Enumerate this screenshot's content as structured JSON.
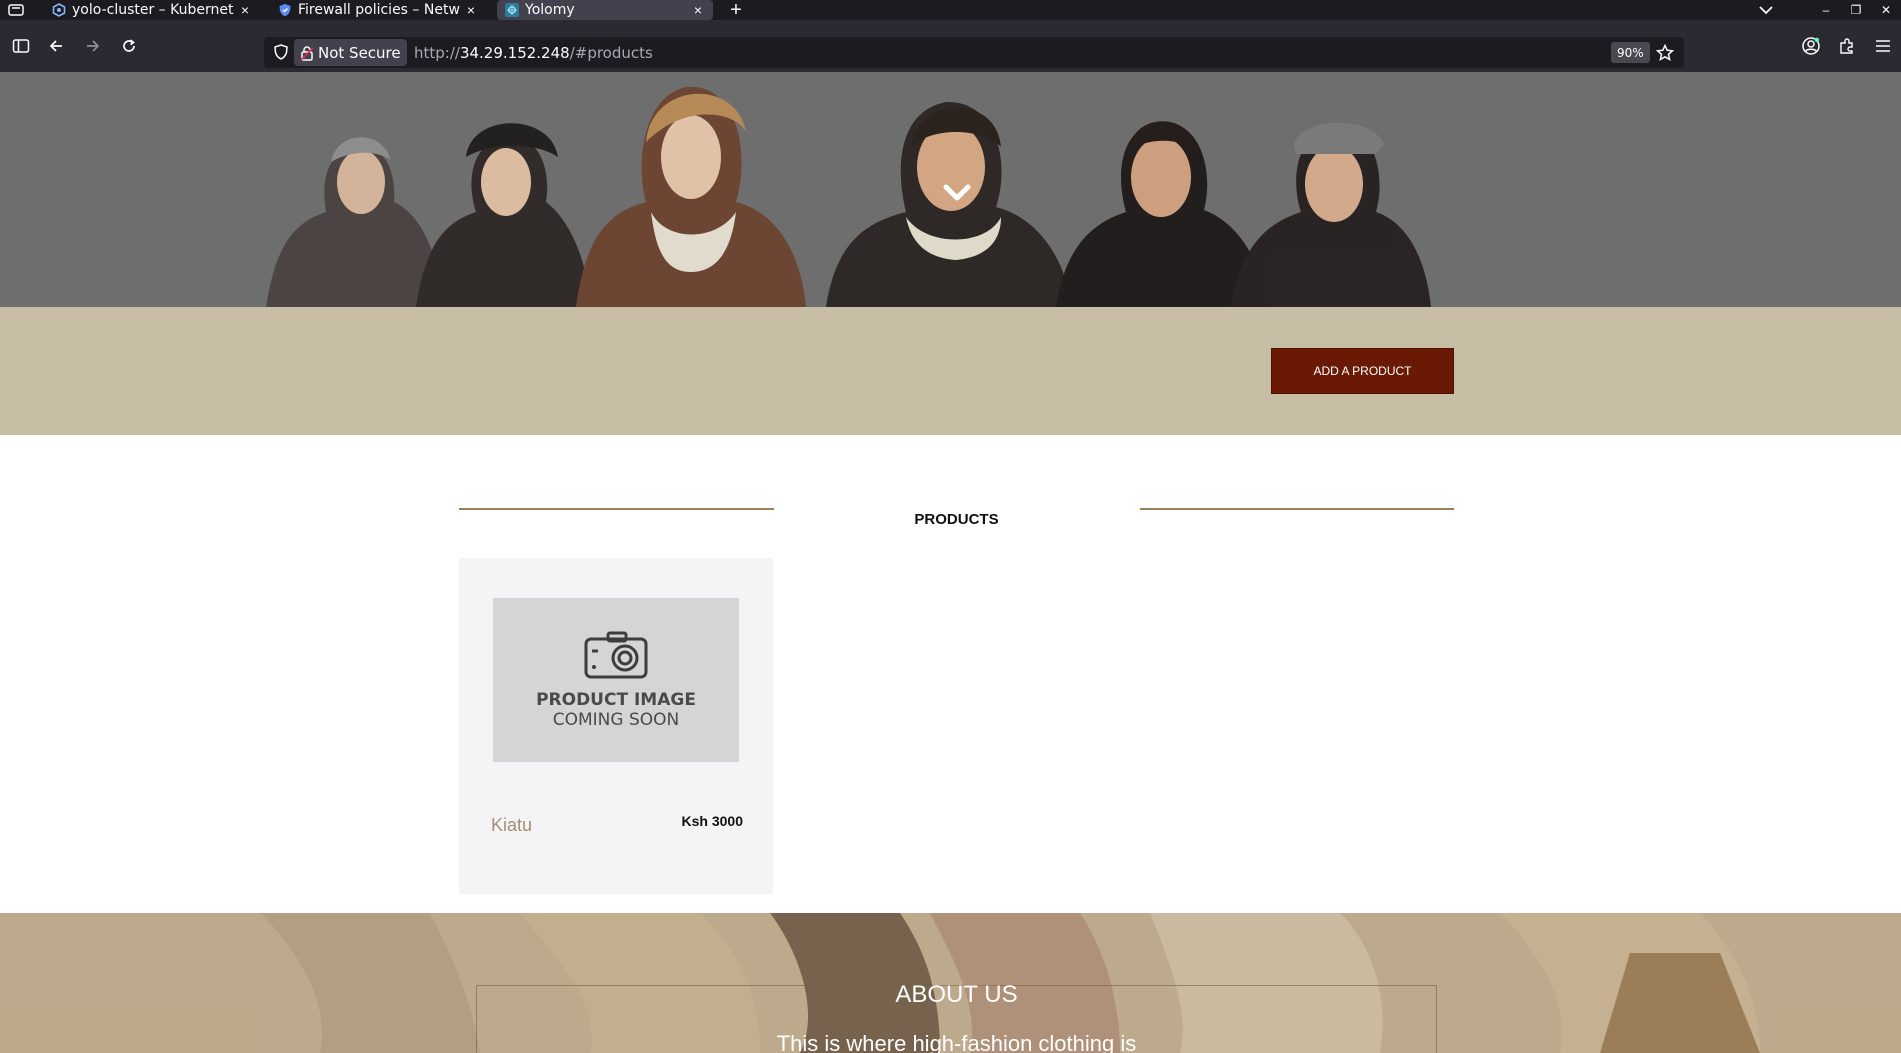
{
  "browser": {
    "tabs": [
      {
        "title": "yolo-cluster – Kubernetes",
        "icon": "kubernetes-icon",
        "active": false
      },
      {
        "title": "Firewall policies – Network",
        "icon": "shield-icon",
        "active": false
      },
      {
        "title": "Yolomy",
        "icon": "yolomy-icon",
        "active": true
      }
    ],
    "new_tab_label": "+",
    "close_glyph": "×",
    "url": {
      "security_label": "Not Secure",
      "prefix": "http://",
      "host": "34.29.152.248",
      "path": "/#products"
    },
    "zoom": "90%"
  },
  "page": {
    "hero": {
      "scroll_icon": "chevron-down-icon"
    },
    "band": {
      "add_button_label": "ADD A PRODUCT"
    },
    "products": {
      "title": "PRODUCTS",
      "items": [
        {
          "image_line1": "PRODUCT IMAGE",
          "image_line2": "COMING SOON",
          "name": "Kiatu",
          "price": "Ksh 3000"
        }
      ]
    },
    "about": {
      "title": "ABOUT US",
      "text": "This is where high-fashion clothing is"
    }
  },
  "colors": {
    "tabbar_bg": "#1c1b22",
    "navbar_bg": "#2b2a33",
    "band_bg": "#c8bea6",
    "button_bg": "#6a1a04",
    "rule": "#9a7e57",
    "product_name": "#a39074"
  }
}
